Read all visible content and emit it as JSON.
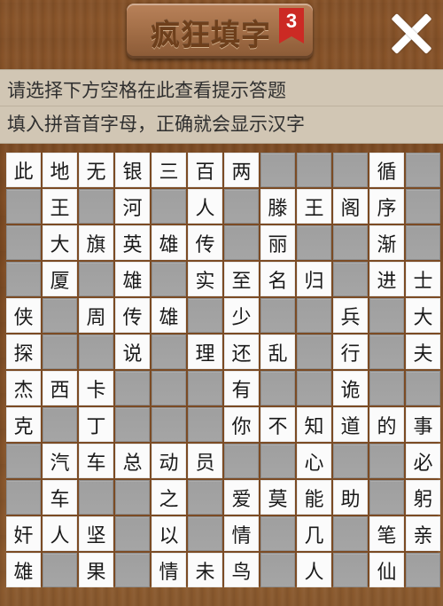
{
  "header": {
    "title": "疯狂填字",
    "level": "3",
    "close_icon": "close-icon"
  },
  "hints": {
    "line1": "请选择下方空格在此查看提示答题",
    "line2": "填入拼音首字母，正确就会显示汉字"
  },
  "colors": {
    "wood": "#7a4a23",
    "hint_panel": "#d1c6b4",
    "filled_cell": "#fbfbfb",
    "empty_cell": "#a3a3a3",
    "badge": "#cc2a24"
  },
  "grid": {
    "rows": [
      [
        "此",
        "地",
        "无",
        "银",
        "三",
        "百",
        "两",
        "",
        "",
        "",
        "循",
        ""
      ],
      [
        "",
        "王",
        "",
        "河",
        "",
        "人",
        "",
        "滕",
        "王",
        "阁",
        "序",
        ""
      ],
      [
        "",
        "大",
        "旗",
        "英",
        "雄",
        "传",
        "",
        "丽",
        "",
        "",
        "渐",
        ""
      ],
      [
        "",
        "厦",
        "",
        "雄",
        "",
        "实",
        "至",
        "名",
        "归",
        "",
        "进",
        "士"
      ],
      [
        "侠",
        "",
        "周",
        "传",
        "雄",
        "",
        "少",
        "",
        "",
        "兵",
        "",
        "大"
      ],
      [
        "探",
        "",
        "",
        "说",
        "",
        "理",
        "还",
        "乱",
        "",
        "行",
        "",
        "夫"
      ],
      [
        "杰",
        "西",
        "卡",
        "",
        "",
        "",
        "有",
        "",
        "",
        "诡",
        "",
        ""
      ],
      [
        "克",
        "",
        "丁",
        "",
        "",
        "",
        "你",
        "不",
        "知",
        "道",
        "的",
        "事"
      ],
      [
        "",
        "汽",
        "车",
        "总",
        "动",
        "员",
        "",
        "",
        "心",
        "",
        "",
        "必"
      ],
      [
        "",
        "车",
        "",
        "",
        "之",
        "",
        "爱",
        "莫",
        "能",
        "助",
        "",
        "躬"
      ],
      [
        "奸",
        "人",
        "坚",
        "",
        "以",
        "",
        "情",
        "",
        "几",
        "",
        "笔",
        "亲"
      ],
      [
        "雄",
        "",
        "果",
        "",
        "情",
        "未",
        "鸟",
        "",
        "人",
        "",
        "仙",
        ""
      ]
    ]
  }
}
